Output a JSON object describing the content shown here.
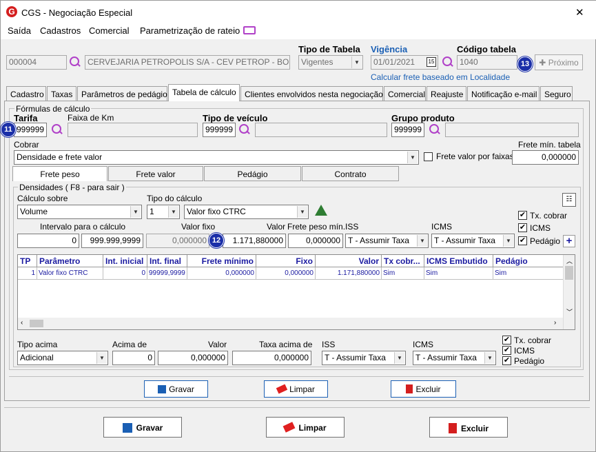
{
  "window": {
    "title": "CGS - Negociação Especial",
    "close": "✕"
  },
  "menu": [
    "Saída",
    "Cadastros",
    "Comercial",
    "Parametrização de rateio"
  ],
  "header": {
    "code": "000004",
    "company": "CERVEJARIA PETROPOLIS S/A  -  CEV PETROP - BOI",
    "tipo_tabela_label": "Tipo de Tabela",
    "tipo_tabela_value": "Vigentes",
    "vigencia_label": "Vigência",
    "vigencia_value": "01/01/2021",
    "calendar": "15",
    "codigo_label": "Código tabela",
    "codigo_value": "1040",
    "proximo": "Próximo",
    "calc_link": "Calcular frete baseado em Localidade"
  },
  "tabs": [
    "Cadastro",
    "Taxas",
    "Parâmetros de pedágio",
    "Tabela de cálculo",
    "Clientes envolvidos nesta negociação",
    "Comercial",
    "Reajuste",
    "Notificação e-mail",
    "Seguro"
  ],
  "formulas": {
    "legend": "Fórmulas de cálculo",
    "tarifa_label": "Tarifa",
    "tarifa_value": "999999",
    "faixa_label": "Faixa de Km",
    "faixa_value": "",
    "tipo_veiculo_label": "Tipo de veículo",
    "tipo_veiculo_value": "999999",
    "grupo_label": "Grupo produto",
    "grupo_value": "999999",
    "cobrar_label": "Cobrar",
    "cobrar_value": "Densidade e frete valor",
    "frete_faixas": "Frete valor por faixas",
    "frete_min_label": "Frete mín. tabela",
    "frete_min_value": "0,000000"
  },
  "subtabs": [
    "Frete peso",
    "Frete valor",
    "Pedágio",
    "Contrato"
  ],
  "densidades": {
    "legend": "Densidades ( F8 - para sair )",
    "calculo_sobre_label": "Cálculo sobre",
    "calculo_sobre_value": "Volume",
    "tipo_calculo_label": "Tipo do cálculo",
    "tipo_calculo_num": "1",
    "tipo_calculo_value": "Valor fixo CTRC",
    "intervalo_label": "Intervalo para o cálculo",
    "intervalo_from": "0",
    "intervalo_to": "999.999,9999",
    "valor_fixo_label": "Valor fixo",
    "valor_fixo_value": "0,000000",
    "valor_label": "Valor",
    "valor_value": "1.171,880000",
    "frete_peso_min_label": "Frete peso mín.",
    "frete_peso_min_value": "0,000000",
    "iss_label": "ISS",
    "iss_value": "T - Assumir Taxa",
    "icms_label": "ICMS",
    "icms_value": "T - Assumir Taxa",
    "checks": [
      "Tx. cobrar",
      "ICMS",
      "Pedágio"
    ]
  },
  "table": {
    "headers": [
      "TP",
      "Parâmetro",
      "Int. inicial",
      "Int. final",
      "Frete mínimo",
      "Fixo",
      "Valor",
      "Tx cobr...",
      "ICMS Embutido",
      "Pedágio"
    ],
    "rows": [
      [
        "1",
        "Valor fixo CTRC",
        "0",
        "99999,9999",
        "0,000000",
        "0,000000",
        "1.171,880000",
        "Sim",
        "Sim",
        "Sim"
      ]
    ]
  },
  "acima": {
    "tipo_label": "Tipo acima",
    "tipo_value": "Adicional",
    "acima_label": "Acima de",
    "acima_value": "0",
    "valor_label": "Valor",
    "valor_value": "0,000000",
    "taxa_label": "Taxa acima de",
    "taxa_value": "0,000000",
    "iss_label": "ISS",
    "iss_value": "T - Assumir Taxa",
    "icms_label": "ICMS",
    "icms_value": "T - Assumir Taxa",
    "checks": [
      "Tx. cobrar",
      "ICMS",
      "Pedágio"
    ]
  },
  "inner_buttons": [
    "Gravar",
    "Limpar",
    "Excluir"
  ],
  "outer_buttons": [
    "Gravar",
    "Limpar",
    "Excluir"
  ],
  "badges": [
    "11",
    "12",
    "13"
  ],
  "colors": {
    "accent": "#1b2fa8",
    "link": "#1a5fb4",
    "header_text": "#1a1aa0",
    "purple": "#b040c8"
  }
}
